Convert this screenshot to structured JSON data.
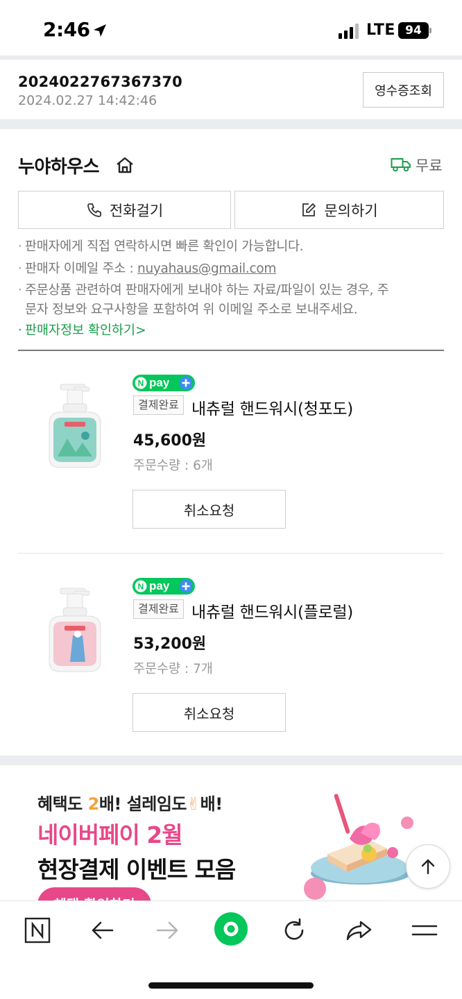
{
  "status_bar": {
    "time": "2:46",
    "network": "LTE",
    "battery": "94"
  },
  "order": {
    "number": "2024022767367370",
    "datetime": "2024.02.27 14:42:46",
    "receipt_button": "영수증조회"
  },
  "seller": {
    "name": "누야하우스",
    "shipping": "무료",
    "call_button": "전화걸기",
    "inquiry_button": "문의하기",
    "notes": {
      "contact": "판매자에게 직접 연락하시면 빠른 확인이 가능합니다.",
      "email_label": "판매자 이메일 주소 : ",
      "email": "nuyahaus@gmail.com",
      "file_line1": "주문상품 관련하여 판매자에게 보내야 하는 자료/파일이 있는 경우, 주",
      "file_line2": "문자 정보와 요구사항을 포함하여 위 이메일 주소로 보내주세요."
    },
    "info_link": "판매자정보 확인하기",
    "info_chevron": ">"
  },
  "products": [
    {
      "badge": "pay",
      "status": "결제완료",
      "name": "내츄럴 핸드워시(청포도)",
      "price": "45,600원",
      "qty_label": "주문수량 : 6개",
      "cancel_button": "취소요청",
      "bottle_color": "#8fd3c7"
    },
    {
      "badge": "pay",
      "status": "결제완료",
      "name": "내츄럴 핸드워시(플로럴)",
      "price": "53,200원",
      "qty_label": "주문수량 : 7개",
      "cancel_button": "취소요청",
      "bottle_color": "#f4c6cf"
    }
  ],
  "banner": {
    "line1_a": "혜택도 ",
    "line1_two": "2",
    "line1_b": "배! 설레임도",
    "line1_hand": "✌",
    "line1_c": "배!",
    "line2": "네이버페이 2월",
    "line3": "현장결제 이벤트 모음",
    "cta": "혜택 확인하기"
  },
  "colors": {
    "accent_green": "#1a9e4a",
    "npay_green": "#03c75a",
    "npay_blue": "#3d8df2",
    "banner_pink": "#e8478a",
    "separator": "#ebecef"
  },
  "icons": [
    "location-arrow-icon",
    "signal-icon",
    "home-icon",
    "truck-icon",
    "phone-icon",
    "edit-icon",
    "arrow-up-icon",
    "naver-n-icon",
    "back-arrow-icon",
    "forward-arrow-icon",
    "green-dot-icon",
    "refresh-icon",
    "share-icon",
    "menu-icon"
  ]
}
